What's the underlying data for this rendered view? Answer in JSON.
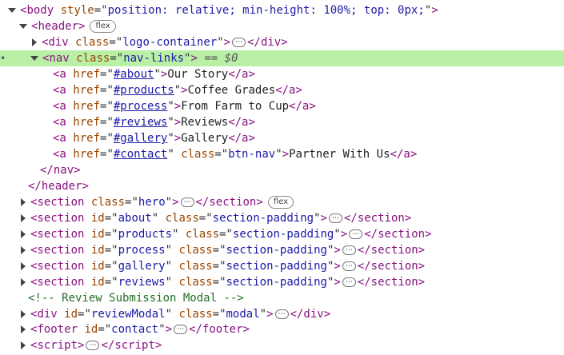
{
  "body_row": {
    "tag": "body",
    "attr": "style",
    "value": "position: relative; min-height: 100%; top: 0px;"
  },
  "header_row": {
    "tag": "header",
    "pill": "flex"
  },
  "logo_row": {
    "tag": "div",
    "attr": "class",
    "value": "logo-container",
    "ellipsis": "⋯",
    "close": "div"
  },
  "nav_row": {
    "tag": "nav",
    "attr": "class",
    "value": "nav-links",
    "marker": "== $0"
  },
  "links": [
    {
      "href": "#about",
      "text": "Our Story"
    },
    {
      "href": "#products",
      "text": "Coffee Grades"
    },
    {
      "href": "#process",
      "text": "From Farm to Cup"
    },
    {
      "href": "#reviews",
      "text": "Reviews"
    },
    {
      "href": "#gallery",
      "text": "Gallery"
    }
  ],
  "contact_link": {
    "href": "#contact",
    "class_attr": "class",
    "class_value": "btn-nav",
    "text": "Partner With Us"
  },
  "nav_close": "nav",
  "header_close": "header",
  "hero_row": {
    "tag": "section",
    "attr": "class",
    "value": "hero",
    "pill": "flex"
  },
  "sections": [
    {
      "id": "about",
      "class": "section-padding"
    },
    {
      "id": "products",
      "class": "section-padding"
    },
    {
      "id": "process",
      "class": "section-padding"
    },
    {
      "id": "gallery",
      "class": "section-padding"
    },
    {
      "id": "reviews",
      "class": "section-padding"
    }
  ],
  "comment": "<!-- Review Submission Modal -->",
  "modal_row": {
    "tag": "div",
    "id": "reviewModal",
    "class": "modal"
  },
  "footer_row": {
    "tag": "footer",
    "id": "contact"
  },
  "script_row": {
    "tag": "script"
  }
}
